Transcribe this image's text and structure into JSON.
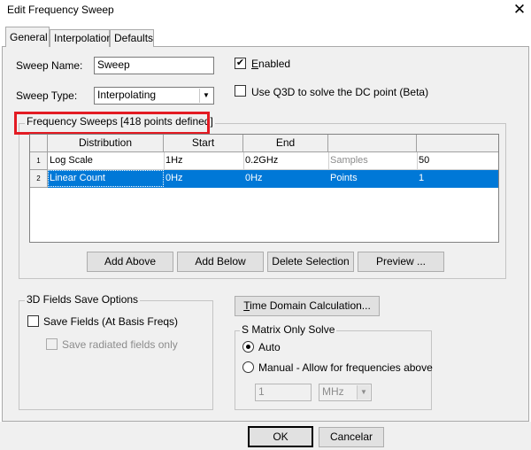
{
  "window": {
    "title": "Edit Frequency Sweep",
    "close_glyph": "✕"
  },
  "tabs": [
    {
      "label": "General",
      "active": true
    },
    {
      "label": "Interpolation",
      "active": false
    },
    {
      "label": "Defaults",
      "active": false
    }
  ],
  "general": {
    "sweep_name_label": "Sweep Name:",
    "sweep_name_value": "Sweep",
    "sweep_type_label": "Sweep Type:",
    "sweep_type_value": "Interpolating",
    "enabled_label": "Enabled",
    "enabled_checked": true,
    "q3d_label": "Use Q3D to solve the DC point (Beta)",
    "q3d_checked": false
  },
  "frequency_sweeps": {
    "title": "Frequency Sweeps [418 points defined]",
    "columns": [
      "Distribution",
      "Start",
      "End",
      "",
      ""
    ],
    "rows": [
      {
        "num": "1",
        "distribution": "Log Scale",
        "start": "1Hz",
        "end": "0.2GHz",
        "type": "Samples",
        "value": "50",
        "selected": false
      },
      {
        "num": "2",
        "distribution": "Linear Count",
        "start": "0Hz",
        "end": "0Hz",
        "type": "Points",
        "value": "1",
        "selected": true
      }
    ],
    "buttons": {
      "add_above": "Add Above",
      "add_below": "Add Below",
      "delete_selection": "Delete Selection",
      "preview": "Preview ..."
    }
  },
  "fields_save": {
    "title": "3D Fields Save Options",
    "save_fields_label": "Save Fields (At Basis Freqs)",
    "save_fields_checked": false,
    "save_radiated_label": "Save radiated fields only",
    "save_radiated_checked": false
  },
  "time_domain_button": "Time Domain Calculation...",
  "s_matrix": {
    "title": "S Matrix Only Solve",
    "auto_label": "Auto",
    "manual_label": "Manual -  Allow for frequencies above",
    "selected": "auto",
    "freq_value": "1",
    "unit_value": "MHz"
  },
  "footer": {
    "ok": "OK",
    "cancel": "Cancelar"
  },
  "colors": {
    "highlight_box": "#e31b23",
    "selection": "#0078d7"
  }
}
